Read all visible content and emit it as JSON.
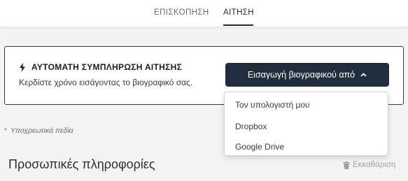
{
  "tabs": [
    {
      "label": "ΕΠΙΣΚΟΠΗΣΗ"
    },
    {
      "label": "ΑΙΤΗΣΗ"
    }
  ],
  "autofill": {
    "title": "ΑΥΤΟΜΑΤΗ ΣΥΜΠΛΗΡΩΣΗ ΑΙΤΗΣΗΣ",
    "subtitle": "Κερδίστε χρόνο εισάγοντας το βιογραφικό σας.",
    "icon": "bolt-icon",
    "import_button_label": "Εισαγωγή βιογραφικού από"
  },
  "import_menu": {
    "items": [
      {
        "label": "Τον υπολογιστή μου"
      },
      {
        "label": "Dropbox"
      },
      {
        "label": "Google Drive"
      }
    ]
  },
  "form": {
    "required_star": "*",
    "required_note": "Υποχρεωτικά πεδία",
    "section_title": "Προσωπικές πληροφορίες",
    "clear_label": "Εκκαθάριση"
  },
  "colors": {
    "button_bg": "#1f2d3d",
    "required_star": "#d9534f",
    "page_bg": "#f4f4f4"
  }
}
